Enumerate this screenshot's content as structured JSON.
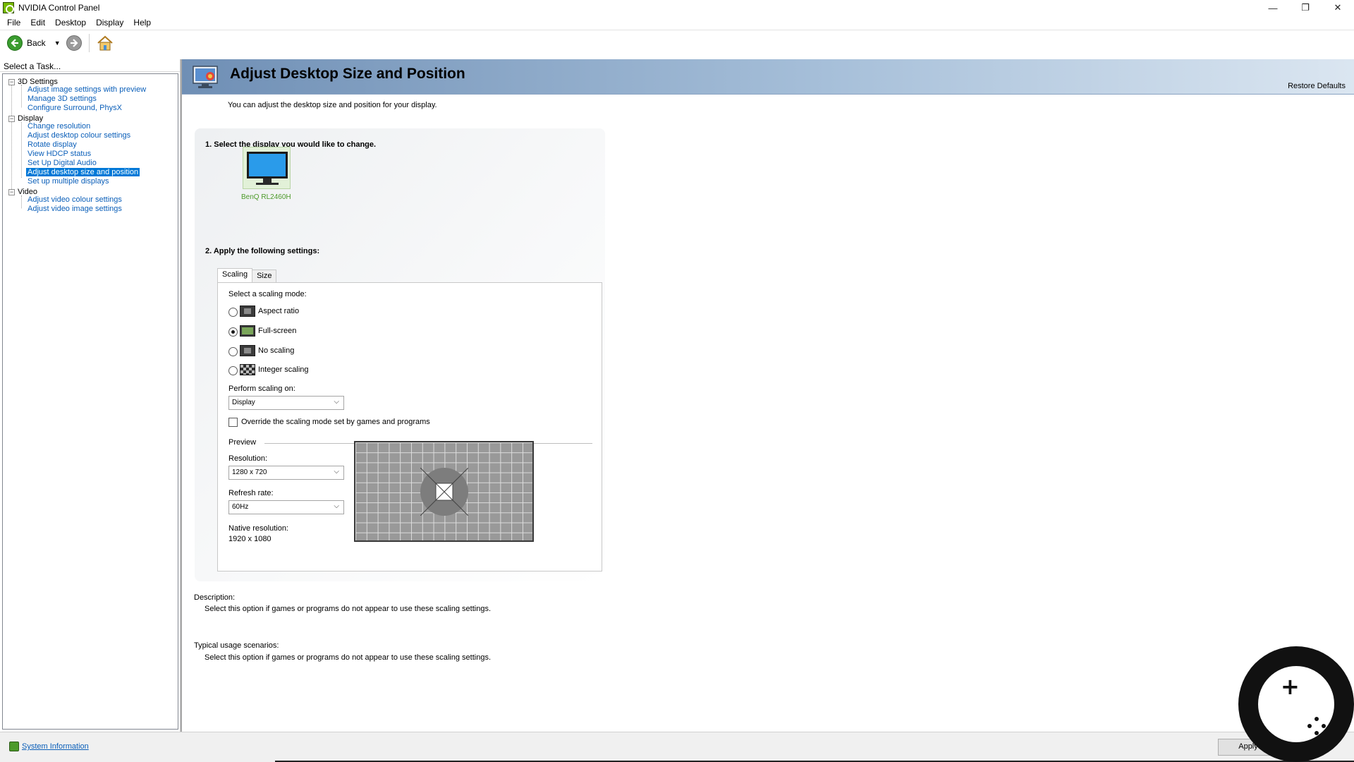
{
  "window": {
    "title": "NVIDIA Control Panel",
    "controls": {
      "minimize": "—",
      "restore": "❐",
      "close": "✕"
    }
  },
  "menu": [
    "File",
    "Edit",
    "Desktop",
    "Display",
    "Help"
  ],
  "toolbar": {
    "back_label": "Back"
  },
  "left_panel": {
    "header": "Select a Task...",
    "categories": [
      {
        "label": "3D Settings",
        "expander": "−",
        "items": [
          "Adjust image settings with preview",
          "Manage 3D settings",
          "Configure Surround, PhysX"
        ]
      },
      {
        "label": "Display",
        "expander": "−",
        "items": [
          "Change resolution",
          "Adjust desktop colour settings",
          "Rotate display",
          "View HDCP status",
          "Set Up Digital Audio",
          "Adjust desktop size and position",
          "Set up multiple displays"
        ]
      },
      {
        "label": "Video",
        "expander": "−",
        "items": [
          "Adjust video colour settings",
          "Adjust video image settings"
        ]
      }
    ],
    "selected_item": "Adjust desktop size and position"
  },
  "page": {
    "title": "Adjust Desktop Size and Position",
    "restore_defaults": "Restore Defaults",
    "description": "You can adjust the desktop size and position for your display.",
    "step1": "1. Select the display you would like to change.",
    "display_name": "BenQ RL2460H",
    "step2": "2. Apply the following settings:",
    "tabs": [
      "Scaling",
      "Size"
    ],
    "active_tab": "Scaling",
    "scaling_prompt": "Select a scaling mode:",
    "scaling_modes": [
      {
        "label": "Aspect ratio",
        "checked": false
      },
      {
        "label": "Full-screen",
        "checked": true
      },
      {
        "label": "No scaling",
        "checked": false
      },
      {
        "label": "Integer scaling",
        "checked": false
      }
    ],
    "perform_scaling_label": "Perform scaling on:",
    "perform_scaling_value": "Display",
    "override_label": "Override the scaling mode set by games and programs",
    "override_checked": false,
    "preview_label": "Preview",
    "resolution_label": "Resolution:",
    "resolution_value": "1280 x 720",
    "refresh_label": "Refresh rate:",
    "refresh_value": "60Hz",
    "native_label": "Native resolution:",
    "native_value": "1920 x 1080",
    "desc_heading": "Description:",
    "desc_text": "Select this option if games or programs do not appear to use these scaling settings.",
    "usage_heading": "Typical usage scenarios:",
    "usage_text": "Select this option if games or programs do not appear to use these scaling settings."
  },
  "bottom": {
    "system_info": "System Information",
    "apply": "Apply"
  },
  "colors": {
    "accent": "#76b900",
    "link": "#0b5fb9",
    "selection": "#0078d7",
    "banner_start": "#6f8fb5",
    "banner_end": "#dbe6f1"
  },
  "icons": {
    "back": "back-arrow-icon",
    "forward": "forward-arrow-icon",
    "home": "home-icon",
    "display": "monitor-icon"
  }
}
